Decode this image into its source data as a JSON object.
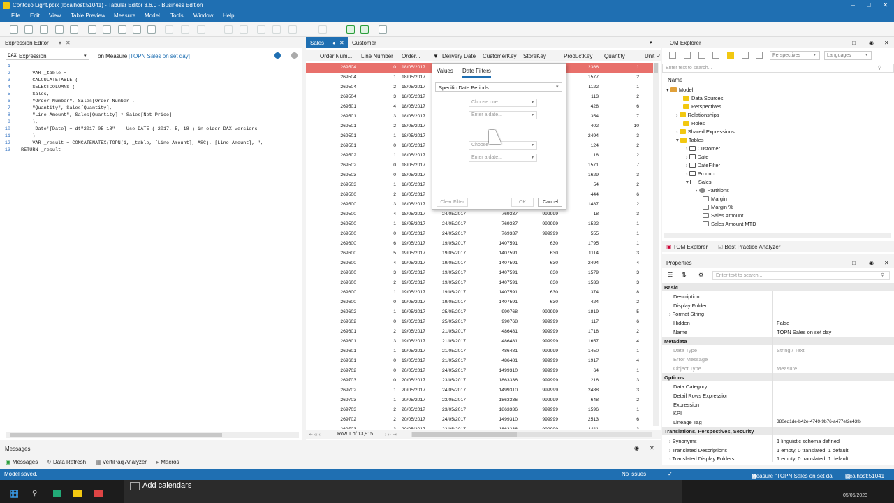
{
  "window": {
    "title": "Contoso Light.pbix (localhost:51041) - Tabular Editor 3.6.0 - Business Edition"
  },
  "menu": [
    "File",
    "Edit",
    "View",
    "Table Preview",
    "Measure",
    "Model",
    "Tools",
    "Window",
    "Help"
  ],
  "expression_editor": {
    "title": "Expression Editor",
    "property": "Expression",
    "context_prefix": "on Measure",
    "context_link": "[TOPN Sales on set day]",
    "code": [
      "    VAR _table =",
      "    CALCULATETABLE (",
      "    SELECTCOLUMNS (",
      "    Sales,",
      "    \"Order Number\", Sales[Order Number],",
      "    \"Quantity\", Sales[Quantity],",
      "    \"Line Amount\", Sales[Quantity] * Sales[Net Price]",
      "    ),",
      "    'Date'[Date] = dt\"2017-05-18\" -- Use DATE ( 2017, 5, 18 ) in older DAX versions",
      "    )",
      "    VAR _result = CONCATENATEX(TOPN(1, _table, [Line Amount], ASC), [Line Amount], \",",
      "RETURN _result"
    ]
  },
  "grid": {
    "tabs": [
      "Sales",
      "Customer"
    ],
    "columns": [
      "Order Num...",
      "Line Number",
      "Order...",
      "Delivery Date",
      "CustomerKey",
      "StoreKey",
      "ProductKey",
      "Quantity",
      "Unit P"
    ],
    "footer": "Row 1 of 13,915",
    "rows": [
      [
        "269504",
        "0",
        "18/05/2017",
        "",
        "",
        "",
        "2366",
        "1"
      ],
      [
        "269504",
        "1",
        "18/05/2017",
        "",
        "",
        "",
        "1577",
        "2"
      ],
      [
        "269504",
        "2",
        "18/05/2017",
        "",
        "",
        "",
        "1122",
        "1"
      ],
      [
        "269504",
        "3",
        "18/05/2017",
        "",
        "",
        "",
        "113",
        "2"
      ],
      [
        "269501",
        "4",
        "18/05/2017",
        "",
        "",
        "",
        "428",
        "6"
      ],
      [
        "269501",
        "3",
        "18/05/2017",
        "",
        "",
        "",
        "354",
        "7"
      ],
      [
        "269501",
        "2",
        "18/05/2017",
        "",
        "",
        "",
        "402",
        "10"
      ],
      [
        "269501",
        "1",
        "18/05/2017",
        "",
        "",
        "",
        "2494",
        "3"
      ],
      [
        "269501",
        "0",
        "18/05/2017",
        "",
        "",
        "",
        "124",
        "2"
      ],
      [
        "269502",
        "1",
        "18/05/2017",
        "",
        "",
        "",
        "18",
        "2"
      ],
      [
        "269502",
        "0",
        "18/05/2017",
        "",
        "",
        "",
        "1571",
        "7"
      ],
      [
        "269503",
        "0",
        "18/05/2017",
        "",
        "",
        "",
        "1629",
        "3"
      ],
      [
        "269503",
        "1",
        "18/05/2017",
        "",
        "",
        "",
        "54",
        "2"
      ],
      [
        "269500",
        "2",
        "18/05/2017",
        "",
        "",
        "",
        "444",
        "6"
      ],
      [
        "269500",
        "3",
        "18/05/2017",
        "",
        "",
        "",
        "1487",
        "2"
      ],
      [
        "269500",
        "4",
        "18/05/2017",
        "24/05/2017",
        "769337",
        "999999",
        "18",
        "3"
      ],
      [
        "269500",
        "1",
        "18/05/2017",
        "24/05/2017",
        "769337",
        "999999",
        "1522",
        "1"
      ],
      [
        "269500",
        "0",
        "18/05/2017",
        "24/05/2017",
        "769337",
        "999999",
        "555",
        "1"
      ],
      [
        "269600",
        "6",
        "19/05/2017",
        "19/05/2017",
        "1407591",
        "630",
        "1795",
        "1"
      ],
      [
        "269600",
        "5",
        "19/05/2017",
        "19/05/2017",
        "1407591",
        "630",
        "1114",
        "3"
      ],
      [
        "269600",
        "4",
        "19/05/2017",
        "19/05/2017",
        "1407591",
        "630",
        "2494",
        "4"
      ],
      [
        "269600",
        "3",
        "19/05/2017",
        "19/05/2017",
        "1407591",
        "630",
        "1579",
        "3"
      ],
      [
        "269600",
        "2",
        "19/05/2017",
        "19/05/2017",
        "1407591",
        "630",
        "1533",
        "3"
      ],
      [
        "269600",
        "1",
        "19/05/2017",
        "19/05/2017",
        "1407591",
        "630",
        "374",
        "8"
      ],
      [
        "269600",
        "0",
        "19/05/2017",
        "19/05/2017",
        "1407591",
        "630",
        "424",
        "2"
      ],
      [
        "269602",
        "1",
        "19/05/2017",
        "25/05/2017",
        "990768",
        "999999",
        "1819",
        "5"
      ],
      [
        "269602",
        "0",
        "19/05/2017",
        "25/05/2017",
        "990768",
        "999999",
        "117",
        "6"
      ],
      [
        "269601",
        "2",
        "19/05/2017",
        "21/05/2017",
        "486481",
        "999999",
        "1718",
        "2"
      ],
      [
        "269601",
        "3",
        "19/05/2017",
        "21/05/2017",
        "486481",
        "999999",
        "1657",
        "4"
      ],
      [
        "269601",
        "1",
        "19/05/2017",
        "21/05/2017",
        "486481",
        "999999",
        "1450",
        "1"
      ],
      [
        "269601",
        "0",
        "19/05/2017",
        "21/05/2017",
        "486481",
        "999999",
        "1917",
        "4"
      ],
      [
        "269702",
        "0",
        "20/05/2017",
        "24/05/2017",
        "1499310",
        "999999",
        "64",
        "1"
      ],
      [
        "269703",
        "0",
        "20/05/2017",
        "23/05/2017",
        "1863336",
        "999999",
        "216",
        "3"
      ],
      [
        "269702",
        "1",
        "20/05/2017",
        "24/05/2017",
        "1499310",
        "999999",
        "2488",
        "3"
      ],
      [
        "269703",
        "1",
        "20/05/2017",
        "23/05/2017",
        "1863336",
        "999999",
        "648",
        "2"
      ],
      [
        "269703",
        "2",
        "20/05/2017",
        "23/05/2017",
        "1863336",
        "999999",
        "1596",
        "1"
      ],
      [
        "269702",
        "2",
        "20/05/2017",
        "24/05/2017",
        "1499310",
        "999999",
        "2513",
        "6"
      ],
      [
        "269703",
        "3",
        "20/05/2017",
        "23/05/2017",
        "1863336",
        "999999",
        "1411",
        "3"
      ]
    ]
  },
  "filter_popup": {
    "tabs": [
      "Values",
      "Date Filters"
    ],
    "mode": "Specific Date Periods",
    "choose1": "Choose one...",
    "date1": "Enter a date...",
    "choose2": "Choose",
    "date2": "Enter a date...",
    "clear": "Clear Filter",
    "ok": "OK",
    "cancel": "Cancel"
  },
  "tom": {
    "title": "TOM Explorer",
    "search_placeholder": "Enter text to search...",
    "perspectives": "Perspectives",
    "languages": "Languages",
    "col_name": "Name",
    "tree": [
      "Model",
      "Data Sources",
      "Perspectives",
      "Relationships",
      "Roles",
      "Shared Expressions",
      "Tables",
      "Customer",
      "Date",
      "DateFilter",
      "Product",
      "Sales",
      "Partitions",
      "Margin",
      "Margin %",
      "Sales Amount",
      "Sales Amount MTD"
    ],
    "tabs": [
      "TOM Explorer",
      "Best Practice Analyzer"
    ]
  },
  "properties": {
    "title": "Properties",
    "search_placeholder": "Enter text to search...",
    "categories": [
      "Basic",
      "Metadata",
      "Options",
      "Translations, Perspectives, Security"
    ],
    "items": [
      [
        "Description",
        ""
      ],
      [
        "Display Folder",
        ""
      ],
      [
        "Format String",
        ""
      ],
      [
        "Hidden",
        "False"
      ],
      [
        "Name",
        "TOPN Sales on set day"
      ],
      [
        "Data Type",
        "String / Text"
      ],
      [
        "Error Message",
        ""
      ],
      [
        "Object Type",
        "Measure"
      ],
      [
        "Data Category",
        ""
      ],
      [
        "Detail Rows Expression",
        ""
      ],
      [
        "Expression",
        ""
      ],
      [
        "KPI",
        ""
      ],
      [
        "Lineage Tag",
        "380ed1de-b42e-4749-9b76-a477ef2e43fb"
      ],
      [
        "Synonyms",
        "1 linguistic schema defined"
      ],
      [
        "Translated Descriptions",
        "1 empty, 0 translated, 1 default"
      ],
      [
        "Translated Display Folders",
        "1 empty, 0 translated, 1 default"
      ]
    ]
  },
  "messages": {
    "title": "Messages",
    "tabs": [
      "Messages",
      "Data Refresh",
      "VertiPaq Analyzer",
      "Macros"
    ]
  },
  "status": {
    "left": "Model saved.",
    "issues": "No issues",
    "measure": "Measure \"TOPN Sales on set da",
    "server": "localhost:51041"
  },
  "taskbar": {
    "popup": "Add calendars",
    "date": "05/05/2023"
  },
  "colors": {
    "accent": "#1f6fb2",
    "highlight_row": "#e8706b"
  }
}
